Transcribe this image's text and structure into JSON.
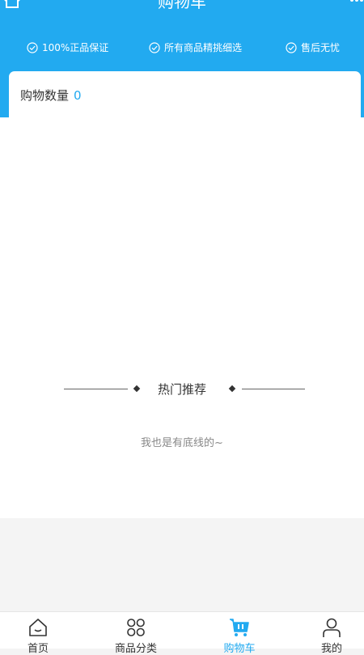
{
  "header": {
    "title": "购物车",
    "guarantees": [
      {
        "label": "100%正品保证",
        "icon": "check-circle-icon"
      },
      {
        "label": "所有商品精挑细选",
        "icon": "check-circle-icon"
      },
      {
        "label": "售后无忧",
        "icon": "check-circle-icon"
      }
    ]
  },
  "cart": {
    "count_label": "购物数量",
    "count_value": "0"
  },
  "recommend": {
    "title": "热门推荐",
    "end_text": "我也是有底线的~"
  },
  "tabbar": {
    "items": [
      {
        "label": "首页",
        "icon": "home-icon"
      },
      {
        "label": "商品分类",
        "icon": "category-grid-icon"
      },
      {
        "label": "购物车",
        "icon": "cart-icon",
        "active": true
      },
      {
        "label": "我的",
        "icon": "user-icon"
      }
    ]
  },
  "colors": {
    "accent": "#22aaf0",
    "background": "#f4f4f4"
  }
}
